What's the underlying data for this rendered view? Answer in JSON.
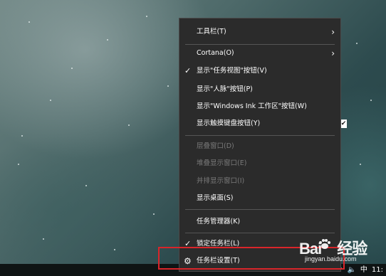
{
  "menu": {
    "toolbars": "工具栏(T)",
    "cortana": "Cortana(O)",
    "show_task_view": "显示\"任务视图\"按钮(V)",
    "show_people": "显示\"人脉\"按钮(P)",
    "show_ink": "显示\"Windows Ink 工作区\"按钮(W)",
    "show_touch_keyboard": "显示触摸键盘按钮(Y)",
    "cascade": "层叠窗口(D)",
    "stacked": "堆叠显示窗口(E)",
    "side_by_side": "并排显示窗口(I)",
    "show_desktop": "显示桌面(S)",
    "task_manager": "任务管理器(K)",
    "lock_taskbar": "锁定任务栏(L)",
    "taskbar_settings": "任务栏设置(T)"
  },
  "icons": {
    "submenu": "chevron-right-icon",
    "checked": "checkmark-icon",
    "settings": "gear-icon",
    "volume": "speaker-icon"
  },
  "tray": {
    "ime": "中",
    "clock": "11:"
  },
  "watermark": {
    "brand_left": "Bai",
    "brand_right": "经验",
    "url": "jingyan.baidu.com"
  },
  "colors": {
    "menu_bg": "#2b2b2b",
    "highlight_border": "#d9252a",
    "disabled_text": "#7a7a7a"
  }
}
